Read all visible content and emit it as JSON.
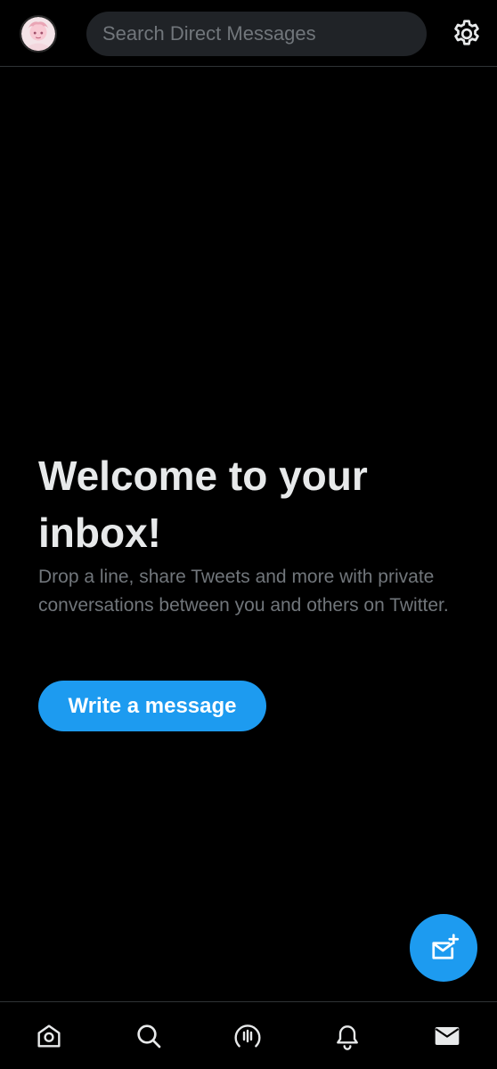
{
  "header": {
    "search_placeholder": "Search Direct Messages",
    "avatar_icon": "profile-avatar",
    "settings_icon": "gear-icon"
  },
  "main": {
    "title": "Welcome to your inbox!",
    "subtitle": "Drop a line, share Tweets and more with private conversations between you and others on Twitter.",
    "write_button_label": "Write a message"
  },
  "fab": {
    "icon": "new-message-icon"
  },
  "bottom_nav": {
    "items": [
      {
        "icon": "home-icon"
      },
      {
        "icon": "search-icon"
      },
      {
        "icon": "spaces-icon"
      },
      {
        "icon": "notifications-bell-icon"
      },
      {
        "icon": "messages-envelope-icon",
        "active": true
      }
    ]
  },
  "colors": {
    "background": "#000000",
    "accent": "#1d9bf0",
    "primary_text": "#e7e9ea",
    "secondary_text": "#71767b",
    "search_bg": "#202327",
    "divider": "#2f3336"
  }
}
